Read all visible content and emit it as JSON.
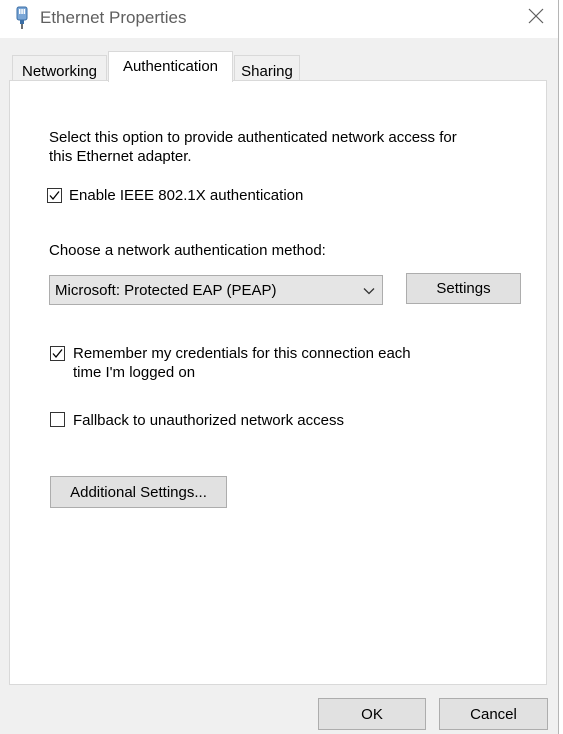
{
  "window": {
    "title": "Ethernet Properties",
    "icon": "network-adapter-icon",
    "close_icon": "close-icon"
  },
  "tabs": [
    {
      "label": "Networking",
      "active": false
    },
    {
      "label": "Authentication",
      "active": true
    },
    {
      "label": "Sharing",
      "active": false
    }
  ],
  "auth": {
    "description_line1": "Select this option to provide authenticated network access for",
    "description_line2": "this Ethernet adapter.",
    "enable_label": "Enable IEEE 802.1X authentication",
    "enable_checked": true,
    "method_label": "Choose a network authentication method:",
    "method_value": "Microsoft: Protected EAP (PEAP)",
    "settings_label": "Settings",
    "remember_label_line1": "Remember my credentials for this connection each",
    "remember_label_line2": "time I'm logged on",
    "remember_checked": true,
    "fallback_label": "Fallback to unauthorized network access",
    "fallback_checked": false,
    "additional_settings_label": "Additional Settings..."
  },
  "footer": {
    "ok_label": "OK",
    "cancel_label": "Cancel"
  }
}
